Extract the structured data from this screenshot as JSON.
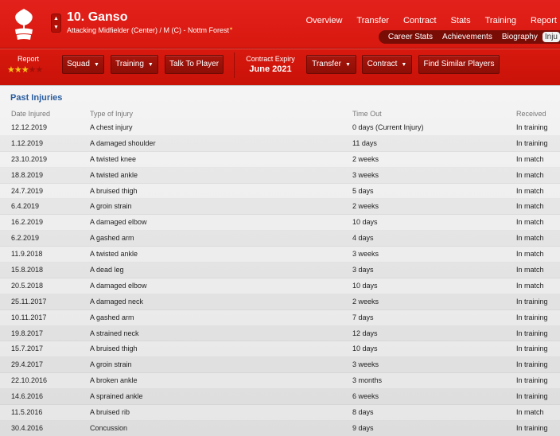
{
  "header": {
    "player_name": "10. Ganso",
    "player_subtitle": "Attacking Midfielder (Center) / M (C) - Nottm Forest",
    "club_crest_icon": "club-crest-icon",
    "stepper": {
      "up": "▲",
      "down": "▼"
    }
  },
  "topnav": {
    "items": [
      "Overview",
      "Transfer",
      "Contract",
      "Stats",
      "Training",
      "Report"
    ]
  },
  "subnav": {
    "items": [
      "Career Stats",
      "Achievements",
      "Biography",
      "Inju"
    ],
    "active_index": 3
  },
  "toolbar": {
    "report_label": "Report",
    "report_rating": 3,
    "report_max": 5,
    "squad_label": "Squad",
    "training_label": "Training",
    "talk_label": "Talk To Player",
    "contract_expiry_label": "Contract Expiry",
    "contract_expiry_value": "June 2021",
    "transfer_label": "Transfer",
    "contract_label": "Contract",
    "similar_label": "Find Similar Players"
  },
  "injuries": {
    "title": "Past Injuries",
    "columns": {
      "date": "Date Injured",
      "type": "Type of Injury",
      "time": "Time Out",
      "received": "Received"
    },
    "rows": [
      {
        "date": "12.12.2019",
        "type": "A chest injury",
        "time": "0 days (Current Injury)",
        "received": "In training"
      },
      {
        "date": "1.12.2019",
        "type": "A damaged shoulder",
        "time": "11 days",
        "received": "In training"
      },
      {
        "date": "23.10.2019",
        "type": "A twisted knee",
        "time": "2 weeks",
        "received": "In match"
      },
      {
        "date": "18.8.2019",
        "type": "A twisted ankle",
        "time": "3 weeks",
        "received": "In match"
      },
      {
        "date": "24.7.2019",
        "type": "A bruised thigh",
        "time": "5 days",
        "received": "In match"
      },
      {
        "date": "6.4.2019",
        "type": "A groin strain",
        "time": "2 weeks",
        "received": "In match"
      },
      {
        "date": "16.2.2019",
        "type": "A damaged elbow",
        "time": "10 days",
        "received": "In match"
      },
      {
        "date": "6.2.2019",
        "type": "A gashed arm",
        "time": "4 days",
        "received": "In match"
      },
      {
        "date": "11.9.2018",
        "type": "A twisted ankle",
        "time": "3 weeks",
        "received": "In match"
      },
      {
        "date": "15.8.2018",
        "type": "A dead leg",
        "time": "3 days",
        "received": "In match"
      },
      {
        "date": "20.5.2018",
        "type": "A damaged elbow",
        "time": "10 days",
        "received": "In match"
      },
      {
        "date": "25.11.2017",
        "type": "A damaged neck",
        "time": "2 weeks",
        "received": "In training"
      },
      {
        "date": "10.11.2017",
        "type": "A gashed arm",
        "time": "7 days",
        "received": "In training"
      },
      {
        "date": "19.8.2017",
        "type": "A strained neck",
        "time": "12 days",
        "received": "In training"
      },
      {
        "date": "15.7.2017",
        "type": "A bruised thigh",
        "time": "10 days",
        "received": "In training"
      },
      {
        "date": "29.4.2017",
        "type": "A groin strain",
        "time": "3 weeks",
        "received": "In training"
      },
      {
        "date": "22.10.2016",
        "type": "A broken ankle",
        "time": "3 months",
        "received": "In training"
      },
      {
        "date": "14.6.2016",
        "type": "A sprained ankle",
        "time": "6 weeks",
        "received": "In training"
      },
      {
        "date": "11.5.2016",
        "type": "A bruised rib",
        "time": "8 days",
        "received": "In match"
      },
      {
        "date": "30.4.2016",
        "type": "Concussion",
        "time": "9 days",
        "received": "In training"
      }
    ]
  },
  "colors": {
    "header_red": "#d8190f",
    "button_red": "#8c0e06",
    "title_blue": "#2a5d9f",
    "star_gold": "#f5c518"
  }
}
